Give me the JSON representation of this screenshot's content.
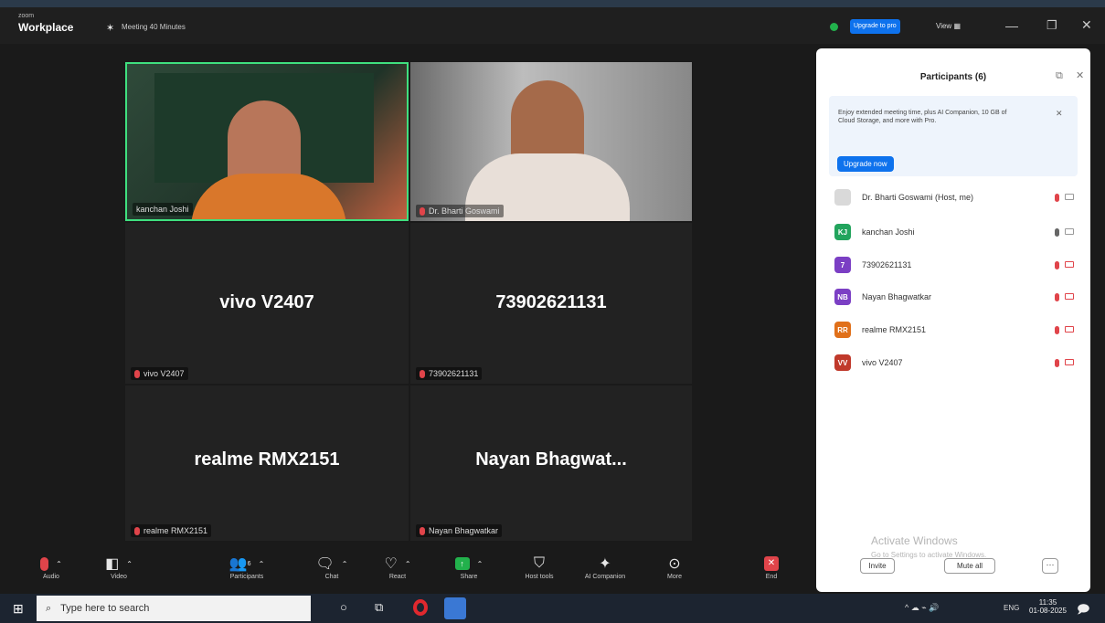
{
  "app": {
    "brand_top": "zoom",
    "brand": "Workplace",
    "meeting_title": "Meeting 40 Minutes",
    "upgrade_label": "Upgrade to pro",
    "view_label": "View"
  },
  "tiles": [
    {
      "label": "kanchan Joshi"
    },
    {
      "label": "Dr. Bharti Goswami"
    },
    {
      "name": "vivo V2407",
      "label": "vivo V2407"
    },
    {
      "name": "73902621131",
      "label": "73902621131"
    },
    {
      "name": "realme RMX2151",
      "label": "realme RMX2151"
    },
    {
      "name": "Nayan  Bhagwat...",
      "label": "Nayan Bhagwatkar"
    }
  ],
  "participants_panel": {
    "title": "Participants (6)",
    "promo_text": "Enjoy extended meeting time, plus AI Companion, 10 GB of Cloud Storage, and more with Pro.",
    "upgrade_button": "Upgrade now",
    "invite_button": "Invite",
    "mute_all_button": "Mute all",
    "participants": [
      {
        "initials": "",
        "name": "Dr. Bharti Goswami (Host, me)",
        "color": "#d9d9d9"
      },
      {
        "initials": "KJ",
        "name": "kanchan Joshi",
        "color": "#22a45d"
      },
      {
        "initials": "7",
        "name": "73902621131",
        "color": "#7b3fc4"
      },
      {
        "initials": "NB",
        "name": "Nayan Bhagwatkar",
        "color": "#7b3fc4"
      },
      {
        "initials": "RR",
        "name": "realme RMX2151",
        "color": "#e0701a"
      },
      {
        "initials": "VV",
        "name": "vivo V2407",
        "color": "#c0392b"
      }
    ]
  },
  "toolbar": {
    "audio": "Audio",
    "video": "Video",
    "participants": "Participants",
    "participants_count": "6",
    "chat": "Chat",
    "react": "React",
    "share": "Share",
    "host_tools": "Host tools",
    "ai_companion": "AI Companion",
    "more": "More",
    "end": "End"
  },
  "watermark": {
    "line1": "Activate Windows",
    "line2": "Go to Settings to activate Windows."
  },
  "taskbar": {
    "search_placeholder": "Type here to search",
    "lang": "ENG",
    "time": "11:35",
    "date": "01-08-2025"
  }
}
